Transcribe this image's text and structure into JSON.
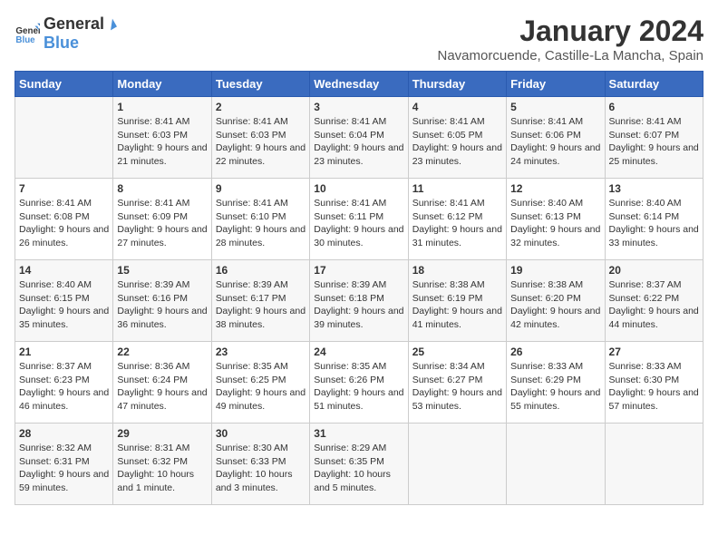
{
  "logo": {
    "general": "General",
    "blue": "Blue"
  },
  "header": {
    "title": "January 2024",
    "subtitle": "Navamorcuende, Castille-La Mancha, Spain"
  },
  "days_of_week": [
    "Sunday",
    "Monday",
    "Tuesday",
    "Wednesday",
    "Thursday",
    "Friday",
    "Saturday"
  ],
  "weeks": [
    [
      {
        "day": "",
        "sunrise": "",
        "sunset": "",
        "daylight": ""
      },
      {
        "day": "1",
        "sunrise": "Sunrise: 8:41 AM",
        "sunset": "Sunset: 6:03 PM",
        "daylight": "Daylight: 9 hours and 21 minutes."
      },
      {
        "day": "2",
        "sunrise": "Sunrise: 8:41 AM",
        "sunset": "Sunset: 6:03 PM",
        "daylight": "Daylight: 9 hours and 22 minutes."
      },
      {
        "day": "3",
        "sunrise": "Sunrise: 8:41 AM",
        "sunset": "Sunset: 6:04 PM",
        "daylight": "Daylight: 9 hours and 23 minutes."
      },
      {
        "day": "4",
        "sunrise": "Sunrise: 8:41 AM",
        "sunset": "Sunset: 6:05 PM",
        "daylight": "Daylight: 9 hours and 23 minutes."
      },
      {
        "day": "5",
        "sunrise": "Sunrise: 8:41 AM",
        "sunset": "Sunset: 6:06 PM",
        "daylight": "Daylight: 9 hours and 24 minutes."
      },
      {
        "day": "6",
        "sunrise": "Sunrise: 8:41 AM",
        "sunset": "Sunset: 6:07 PM",
        "daylight": "Daylight: 9 hours and 25 minutes."
      }
    ],
    [
      {
        "day": "7",
        "sunrise": "Sunrise: 8:41 AM",
        "sunset": "Sunset: 6:08 PM",
        "daylight": "Daylight: 9 hours and 26 minutes."
      },
      {
        "day": "8",
        "sunrise": "Sunrise: 8:41 AM",
        "sunset": "Sunset: 6:09 PM",
        "daylight": "Daylight: 9 hours and 27 minutes."
      },
      {
        "day": "9",
        "sunrise": "Sunrise: 8:41 AM",
        "sunset": "Sunset: 6:10 PM",
        "daylight": "Daylight: 9 hours and 28 minutes."
      },
      {
        "day": "10",
        "sunrise": "Sunrise: 8:41 AM",
        "sunset": "Sunset: 6:11 PM",
        "daylight": "Daylight: 9 hours and 30 minutes."
      },
      {
        "day": "11",
        "sunrise": "Sunrise: 8:41 AM",
        "sunset": "Sunset: 6:12 PM",
        "daylight": "Daylight: 9 hours and 31 minutes."
      },
      {
        "day": "12",
        "sunrise": "Sunrise: 8:40 AM",
        "sunset": "Sunset: 6:13 PM",
        "daylight": "Daylight: 9 hours and 32 minutes."
      },
      {
        "day": "13",
        "sunrise": "Sunrise: 8:40 AM",
        "sunset": "Sunset: 6:14 PM",
        "daylight": "Daylight: 9 hours and 33 minutes."
      }
    ],
    [
      {
        "day": "14",
        "sunrise": "Sunrise: 8:40 AM",
        "sunset": "Sunset: 6:15 PM",
        "daylight": "Daylight: 9 hours and 35 minutes."
      },
      {
        "day": "15",
        "sunrise": "Sunrise: 8:39 AM",
        "sunset": "Sunset: 6:16 PM",
        "daylight": "Daylight: 9 hours and 36 minutes."
      },
      {
        "day": "16",
        "sunrise": "Sunrise: 8:39 AM",
        "sunset": "Sunset: 6:17 PM",
        "daylight": "Daylight: 9 hours and 38 minutes."
      },
      {
        "day": "17",
        "sunrise": "Sunrise: 8:39 AM",
        "sunset": "Sunset: 6:18 PM",
        "daylight": "Daylight: 9 hours and 39 minutes."
      },
      {
        "day": "18",
        "sunrise": "Sunrise: 8:38 AM",
        "sunset": "Sunset: 6:19 PM",
        "daylight": "Daylight: 9 hours and 41 minutes."
      },
      {
        "day": "19",
        "sunrise": "Sunrise: 8:38 AM",
        "sunset": "Sunset: 6:20 PM",
        "daylight": "Daylight: 9 hours and 42 minutes."
      },
      {
        "day": "20",
        "sunrise": "Sunrise: 8:37 AM",
        "sunset": "Sunset: 6:22 PM",
        "daylight": "Daylight: 9 hours and 44 minutes."
      }
    ],
    [
      {
        "day": "21",
        "sunrise": "Sunrise: 8:37 AM",
        "sunset": "Sunset: 6:23 PM",
        "daylight": "Daylight: 9 hours and 46 minutes."
      },
      {
        "day": "22",
        "sunrise": "Sunrise: 8:36 AM",
        "sunset": "Sunset: 6:24 PM",
        "daylight": "Daylight: 9 hours and 47 minutes."
      },
      {
        "day": "23",
        "sunrise": "Sunrise: 8:35 AM",
        "sunset": "Sunset: 6:25 PM",
        "daylight": "Daylight: 9 hours and 49 minutes."
      },
      {
        "day": "24",
        "sunrise": "Sunrise: 8:35 AM",
        "sunset": "Sunset: 6:26 PM",
        "daylight": "Daylight: 9 hours and 51 minutes."
      },
      {
        "day": "25",
        "sunrise": "Sunrise: 8:34 AM",
        "sunset": "Sunset: 6:27 PM",
        "daylight": "Daylight: 9 hours and 53 minutes."
      },
      {
        "day": "26",
        "sunrise": "Sunrise: 8:33 AM",
        "sunset": "Sunset: 6:29 PM",
        "daylight": "Daylight: 9 hours and 55 minutes."
      },
      {
        "day": "27",
        "sunrise": "Sunrise: 8:33 AM",
        "sunset": "Sunset: 6:30 PM",
        "daylight": "Daylight: 9 hours and 57 minutes."
      }
    ],
    [
      {
        "day": "28",
        "sunrise": "Sunrise: 8:32 AM",
        "sunset": "Sunset: 6:31 PM",
        "daylight": "Daylight: 9 hours and 59 minutes."
      },
      {
        "day": "29",
        "sunrise": "Sunrise: 8:31 AM",
        "sunset": "Sunset: 6:32 PM",
        "daylight": "Daylight: 10 hours and 1 minute."
      },
      {
        "day": "30",
        "sunrise": "Sunrise: 8:30 AM",
        "sunset": "Sunset: 6:33 PM",
        "daylight": "Daylight: 10 hours and 3 minutes."
      },
      {
        "day": "31",
        "sunrise": "Sunrise: 8:29 AM",
        "sunset": "Sunset: 6:35 PM",
        "daylight": "Daylight: 10 hours and 5 minutes."
      },
      {
        "day": "",
        "sunrise": "",
        "sunset": "",
        "daylight": ""
      },
      {
        "day": "",
        "sunrise": "",
        "sunset": "",
        "daylight": ""
      },
      {
        "day": "",
        "sunrise": "",
        "sunset": "",
        "daylight": ""
      }
    ]
  ]
}
